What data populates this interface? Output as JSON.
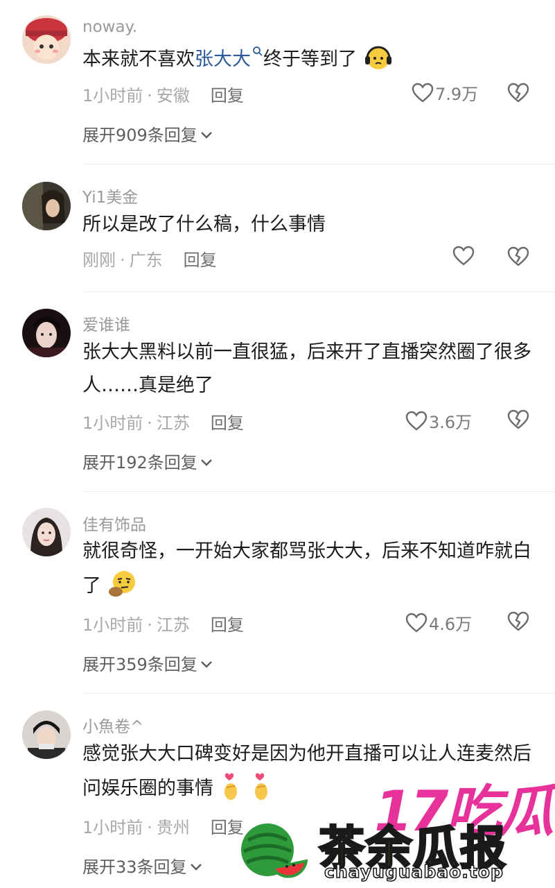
{
  "comments": [
    {
      "username": "noway.",
      "text_before": "本来就不喜欢",
      "highlight": "张大大",
      "text_after": "终于等到了",
      "time": "1小时前",
      "location": "安徽",
      "reply_label": "回复",
      "likes": "7.9万",
      "expand": "展开909条回复"
    },
    {
      "username": "Yi1美金",
      "text": "所以是改了什么稿，什么事情",
      "time": "刚刚",
      "location": "广东",
      "reply_label": "回复",
      "likes": ""
    },
    {
      "username": "爱谁谁",
      "text": "张大大黑料以前一直很猛，后来开了直播突然圈了很多人……真是绝了",
      "time": "1小时前",
      "location": "江苏",
      "reply_label": "回复",
      "likes": "3.6万",
      "expand": "展开192条回复"
    },
    {
      "username": "佳有饰品",
      "text": "就很奇怪，一开始大家都骂张大大，后来不知道咋就白了",
      "time": "1小时前",
      "location": "江苏",
      "reply_label": "回复",
      "likes": "4.6万",
      "expand": "展开359条回复"
    },
    {
      "username": "小魚卷^",
      "text": "感觉张大大口碑变好是因为他开直播可以让人连麦然后问娱乐圈的事情",
      "time": "1小时前",
      "location": "贵州",
      "reply_label": "回复",
      "likes": "",
      "expand": "展开33条回复"
    }
  ],
  "watermark": {
    "brand_top": "17吃瓜",
    "brand_main": "茶余瓜报",
    "url": "chayuguabao.top"
  },
  "icons": [
    "heart-outline-icon",
    "broken-heart-icon",
    "chevron-down-icon",
    "search-mini-icon"
  ],
  "colors": {
    "link": "#2d5a98",
    "meta": "#a8a8a8",
    "watermark_pink": "#e8329b",
    "watermark_yellow": "#f5e600"
  }
}
